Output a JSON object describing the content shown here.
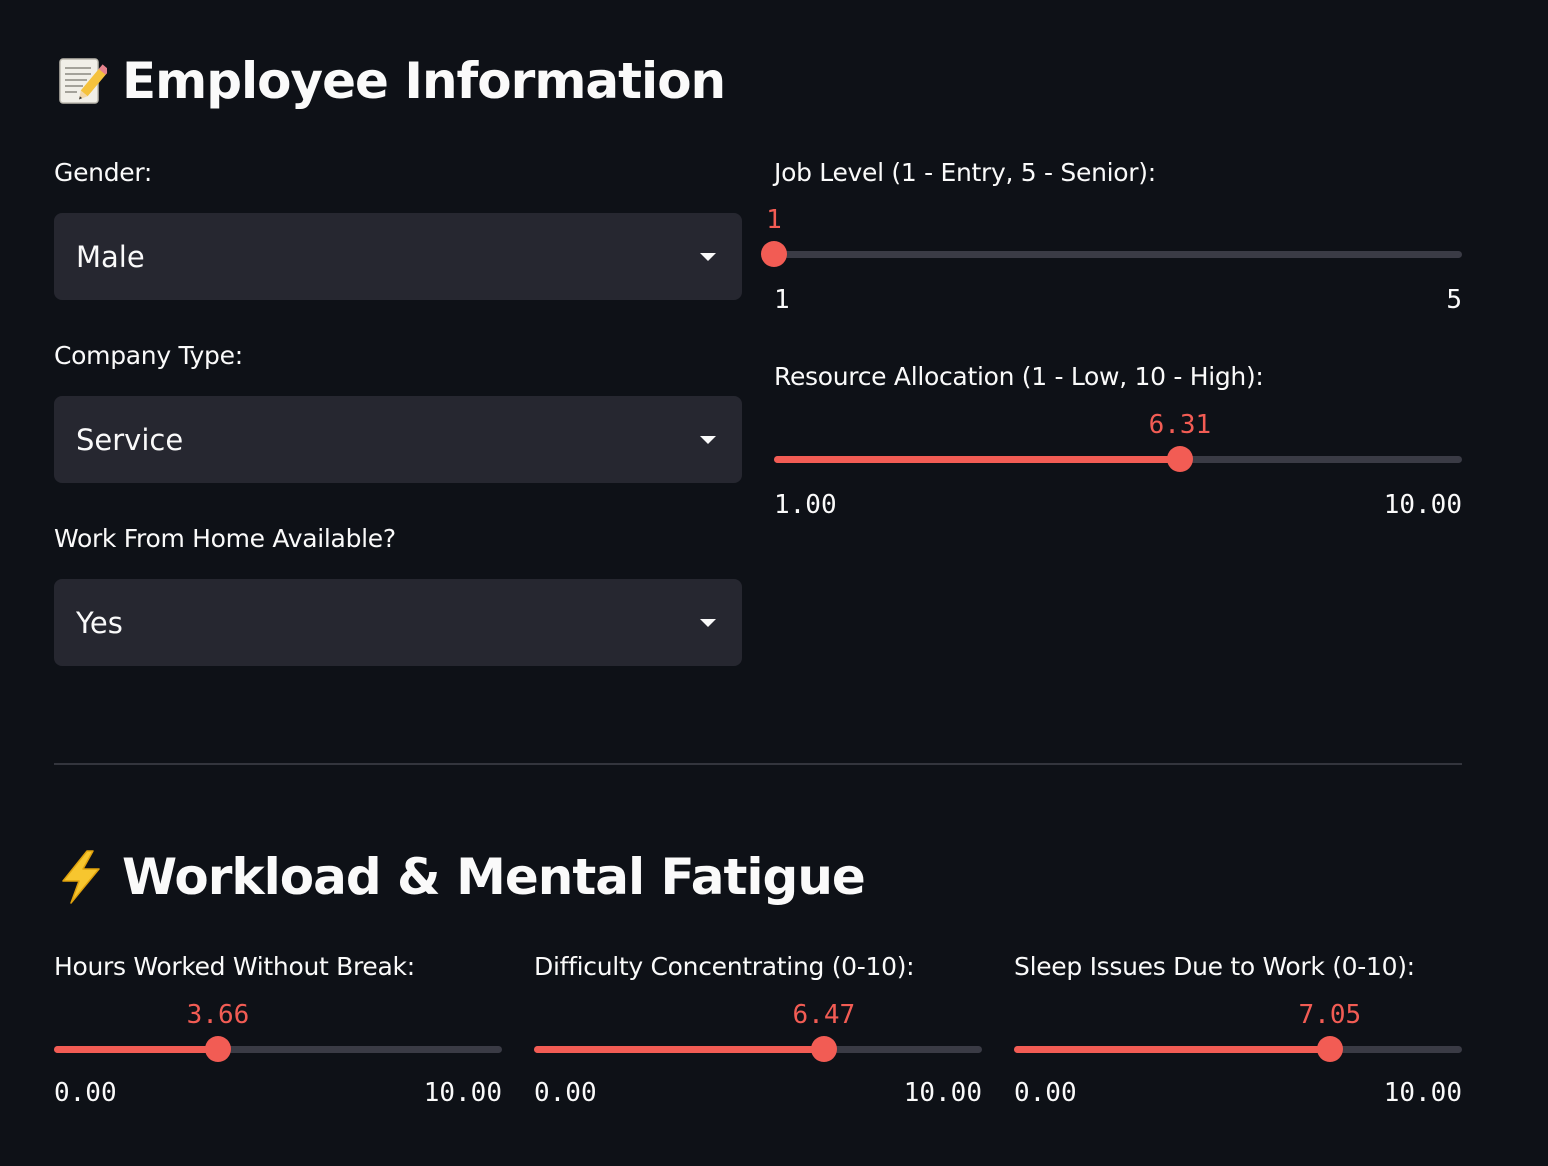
{
  "employee_section": {
    "icon": "memo-icon",
    "title": "Employee Information",
    "gender": {
      "label": "Gender:",
      "value": "Male"
    },
    "company_type": {
      "label": "Company Type:",
      "value": "Service"
    },
    "wfh": {
      "label": "Work From Home Available?",
      "value": "Yes"
    },
    "job_level": {
      "label": "Job Level (1 - Entry, 5 - Senior):",
      "value": "1",
      "min": "1",
      "max": "5",
      "fraction": 0.0
    },
    "resource_allocation": {
      "label": "Resource Allocation (1 - Low, 10 - High):",
      "value": "6.31",
      "min": "1.00",
      "max": "10.00",
      "fraction": 0.59
    }
  },
  "workload_section": {
    "icon": "high-voltage-icon",
    "title": "Workload & Mental Fatigue",
    "hours_worked": {
      "label": "Hours Worked Without Break:",
      "value": "3.66",
      "min": "0.00",
      "max": "10.00",
      "fraction": 0.366
    },
    "difficulty_concentrating": {
      "label": "Difficulty Concentrating (0-10):",
      "value": "6.47",
      "min": "0.00",
      "max": "10.00",
      "fraction": 0.647
    },
    "sleep_issues": {
      "label": "Sleep Issues Due to Work (0-10):",
      "value": "7.05",
      "min": "0.00",
      "max": "10.00",
      "fraction": 0.705
    }
  },
  "colors": {
    "background": "#0e1117",
    "select_bg": "#262730",
    "accent": "#f25c54",
    "track": "#3a3b45",
    "text": "#fafafa"
  }
}
